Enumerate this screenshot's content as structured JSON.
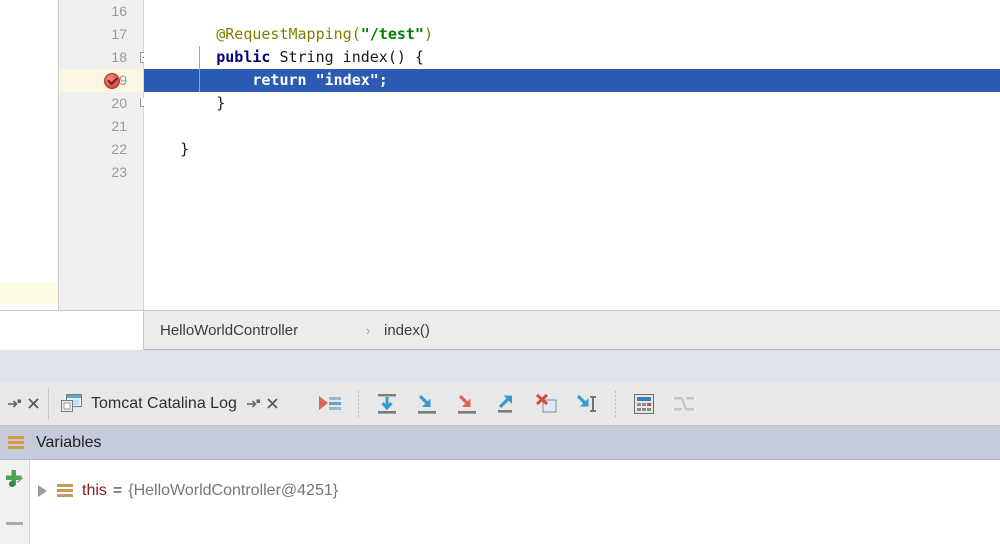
{
  "editor": {
    "lines": [
      {
        "number": "16",
        "segments": []
      },
      {
        "number": "17",
        "segments": [
          {
            "text": "        ",
            "cls": "tok-plain"
          },
          {
            "text": "@RequestMapping(",
            "cls": "tok-anno"
          },
          {
            "text": "\"/test\"",
            "cls": "tok-str"
          },
          {
            "text": ")",
            "cls": "tok-anno"
          }
        ]
      },
      {
        "number": "18",
        "segments": [
          {
            "text": "        ",
            "cls": "tok-plain"
          },
          {
            "text": "public",
            "cls": "tok-kw"
          },
          {
            "text": " String index() {",
            "cls": "tok-plain"
          }
        ]
      },
      {
        "number": "19",
        "segments": [
          {
            "text": "            return \"index\";",
            "cls": "tok-sel"
          }
        ]
      },
      {
        "number": "20",
        "segments": [
          {
            "text": "        }",
            "cls": "tok-plain"
          }
        ]
      },
      {
        "number": "21",
        "segments": []
      },
      {
        "number": "22",
        "segments": [
          {
            "text": "    }",
            "cls": "tok-plain"
          }
        ]
      },
      {
        "number": "23",
        "segments": []
      }
    ],
    "breakpoint_line": "19",
    "current_line": "19",
    "colors": {
      "selection": "#2c5bb5",
      "gutter_highlight": "#fdf6e3",
      "annotation": "#808000",
      "string": "#008000",
      "keyword": "#000080",
      "breakpoint": "#e05c52"
    }
  },
  "breadcrumb": {
    "class_name": "HelloWorldController",
    "separator": "›",
    "method_name": "index()"
  },
  "toolwindow": {
    "left_tab": {
      "detach_icon": "detach-icon",
      "close_icon": "close-icon"
    },
    "tab": {
      "icon": "console-window-icon",
      "label": "Tomcat Catalina Log",
      "detach_icon": "detach-icon",
      "close_icon": "close-icon"
    },
    "toolbar_buttons": [
      {
        "name": "show-execution-point",
        "icon": "show-execution-point-icon"
      },
      {
        "name": "step-over",
        "icon": "step-over-icon"
      },
      {
        "name": "step-into",
        "icon": "step-into-icon"
      },
      {
        "name": "force-step-into",
        "icon": "force-step-into-icon"
      },
      {
        "name": "step-out",
        "icon": "step-out-icon"
      },
      {
        "name": "drop-frame",
        "icon": "drop-frame-icon"
      },
      {
        "name": "run-to-cursor",
        "icon": "run-to-cursor-icon"
      },
      {
        "name": "evaluate-expression",
        "icon": "calculator-icon"
      },
      {
        "name": "mute-breakpoints",
        "icon": "threads-view-icon"
      }
    ]
  },
  "variables": {
    "title": "Variables",
    "title_icon": "variables-icon",
    "add_watch_icon": "add-watch-icon",
    "remove_watch_icon": "remove-watch-icon",
    "rows": [
      {
        "expander": "collapsed-triangle-icon",
        "icon": "object-value-icon",
        "name": "this",
        "equals": "=",
        "value": "{HelloWorldController@4251}"
      }
    ]
  }
}
